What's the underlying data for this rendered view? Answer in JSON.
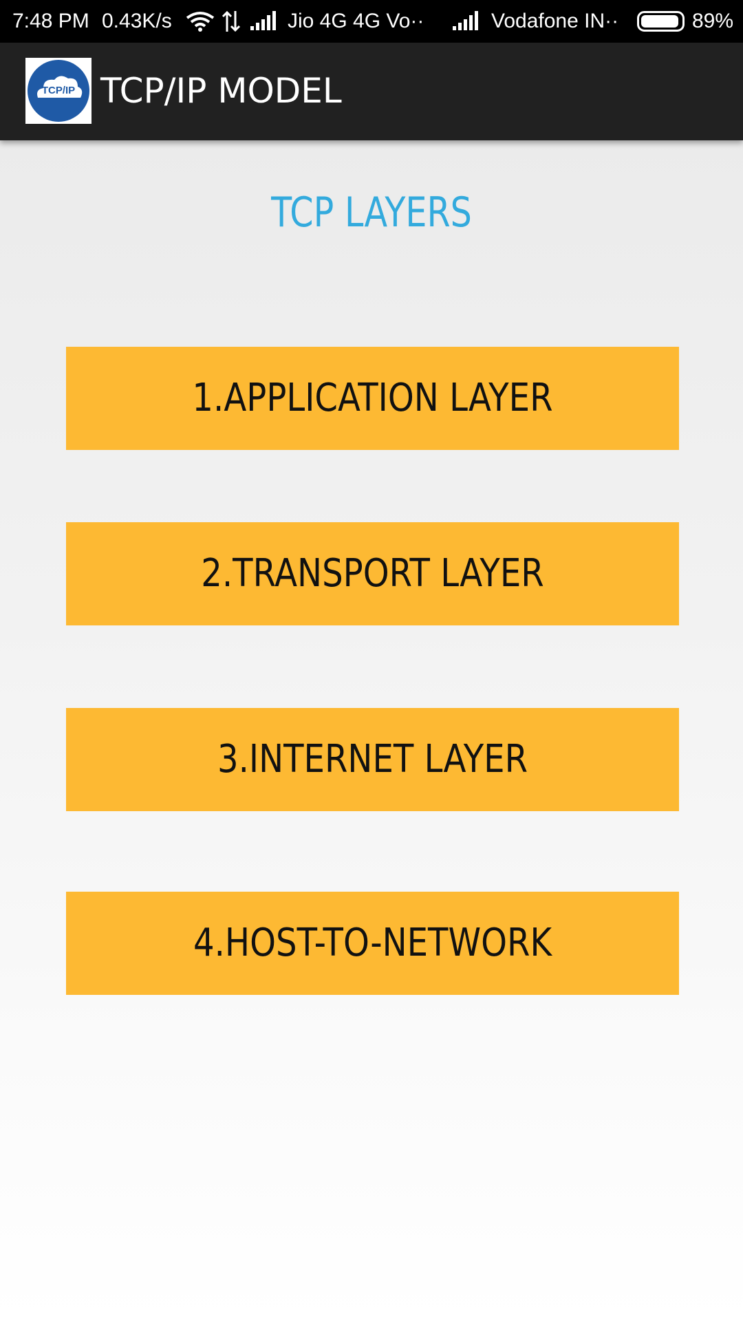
{
  "status_bar": {
    "time": "7:48 PM",
    "speed": "0.43K/s",
    "carrier1": "Jio 4G 4G Vo··",
    "carrier2": "Vodafone IN··",
    "battery": "89%",
    "battery_level": 0.89
  },
  "app_bar": {
    "logo_text": "TCP/IP",
    "title": "TCP/IP MODEL"
  },
  "main": {
    "heading": "TCP LAYERS",
    "layers": [
      {
        "label": "1.APPLICATION LAYER"
      },
      {
        "label": "2.TRANSPORT LAYER"
      },
      {
        "label": "3.INTERNET LAYER"
      },
      {
        "label": "4.HOST-TO-NETWORK"
      }
    ]
  },
  "colors": {
    "status_bar_bg": "#000000",
    "app_bar_bg": "#212121",
    "heading": "#33aadd",
    "button_bg": "#fdb933",
    "button_text": "#111111",
    "logo_blue": "#1f5aa6"
  },
  "icons": [
    "wifi-icon",
    "data-arrows-icon",
    "signal-icon",
    "battery-icon",
    "tcp-ip-cloud-logo"
  ]
}
